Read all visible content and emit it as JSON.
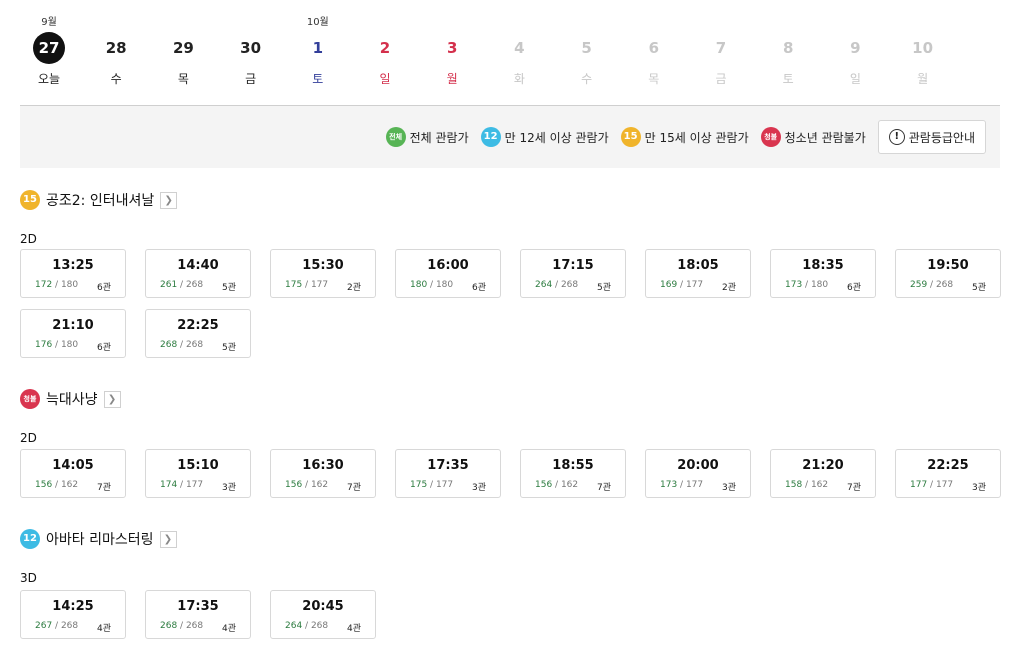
{
  "dates": [
    {
      "month": "9월",
      "num": "27",
      "wd": "오늘",
      "state": "selected"
    },
    {
      "month": "",
      "num": "28",
      "wd": "수",
      "state": ""
    },
    {
      "month": "",
      "num": "29",
      "wd": "목",
      "state": ""
    },
    {
      "month": "",
      "num": "30",
      "wd": "금",
      "state": ""
    },
    {
      "month": "10월",
      "num": "1",
      "wd": "토",
      "state": "sat"
    },
    {
      "month": "",
      "num": "2",
      "wd": "일",
      "state": "sun"
    },
    {
      "month": "",
      "num": "3",
      "wd": "월",
      "state": "sun"
    },
    {
      "month": "",
      "num": "4",
      "wd": "화",
      "state": "disabled"
    },
    {
      "month": "",
      "num": "5",
      "wd": "수",
      "state": "disabled"
    },
    {
      "month": "",
      "num": "6",
      "wd": "목",
      "state": "disabled"
    },
    {
      "month": "",
      "num": "7",
      "wd": "금",
      "state": "disabled"
    },
    {
      "month": "",
      "num": "8",
      "wd": "토",
      "state": "disabled"
    },
    {
      "month": "",
      "num": "9",
      "wd": "일",
      "state": "disabled"
    },
    {
      "month": "",
      "num": "10",
      "wd": "월",
      "state": "disabled"
    }
  ],
  "legend": {
    "items": [
      {
        "badge": "전체",
        "cls": "all",
        "label": "전체 관람가"
      },
      {
        "badge": "12",
        "cls": "b12",
        "label": "만 12세 이상 관람가"
      },
      {
        "badge": "15",
        "cls": "b15",
        "label": "만 15세 이상 관람가"
      },
      {
        "badge": "청불",
        "cls": "b18",
        "label": "청소년 관람불가"
      }
    ],
    "guide_label": "관람등급안내",
    "guide_icon": "!"
  },
  "colors": {
    "green": "#57b455",
    "blue": "#3dbbe4",
    "yellow": "#f0b42b",
    "red": "#d9354f",
    "sat": "#333f9a",
    "sun": "#d4304c"
  },
  "movies": [
    {
      "badge": "15",
      "cls": "b15",
      "title": "공조2: 인터내셔날",
      "format": "2D",
      "slots": [
        {
          "time": "13:25",
          "rem": "172",
          "total": "180",
          "hall": "6관"
        },
        {
          "time": "14:40",
          "rem": "261",
          "total": "268",
          "hall": "5관"
        },
        {
          "time": "15:30",
          "rem": "175",
          "total": "177",
          "hall": "2관"
        },
        {
          "time": "16:00",
          "rem": "180",
          "total": "180",
          "hall": "6관"
        },
        {
          "time": "17:15",
          "rem": "264",
          "total": "268",
          "hall": "5관"
        },
        {
          "time": "18:05",
          "rem": "169",
          "total": "177",
          "hall": "2관"
        },
        {
          "time": "18:35",
          "rem": "173",
          "total": "180",
          "hall": "6관"
        },
        {
          "time": "19:50",
          "rem": "259",
          "total": "268",
          "hall": "5관"
        },
        {
          "time": "21:10",
          "rem": "176",
          "total": "180",
          "hall": "6관"
        },
        {
          "time": "22:25",
          "rem": "268",
          "total": "268",
          "hall": "5관"
        }
      ]
    },
    {
      "badge": "청불",
      "cls": "b18",
      "title": "늑대사냥",
      "format": "2D",
      "slots": [
        {
          "time": "14:05",
          "rem": "156",
          "total": "162",
          "hall": "7관"
        },
        {
          "time": "15:10",
          "rem": "174",
          "total": "177",
          "hall": "3관"
        },
        {
          "time": "16:30",
          "rem": "156",
          "total": "162",
          "hall": "7관"
        },
        {
          "time": "17:35",
          "rem": "175",
          "total": "177",
          "hall": "3관"
        },
        {
          "time": "18:55",
          "rem": "156",
          "total": "162",
          "hall": "7관"
        },
        {
          "time": "20:00",
          "rem": "173",
          "total": "177",
          "hall": "3관"
        },
        {
          "time": "21:20",
          "rem": "158",
          "total": "162",
          "hall": "7관"
        },
        {
          "time": "22:25",
          "rem": "177",
          "total": "177",
          "hall": "3관"
        }
      ]
    },
    {
      "badge": "12",
      "cls": "b12",
      "title": "아바타 리마스터링",
      "format": "3D",
      "slots": [
        {
          "time": "14:25",
          "rem": "267",
          "total": "268",
          "hall": "4관"
        },
        {
          "time": "17:35",
          "rem": "268",
          "total": "268",
          "hall": "4관"
        },
        {
          "time": "20:45",
          "rem": "264",
          "total": "268",
          "hall": "4관"
        }
      ]
    }
  ]
}
